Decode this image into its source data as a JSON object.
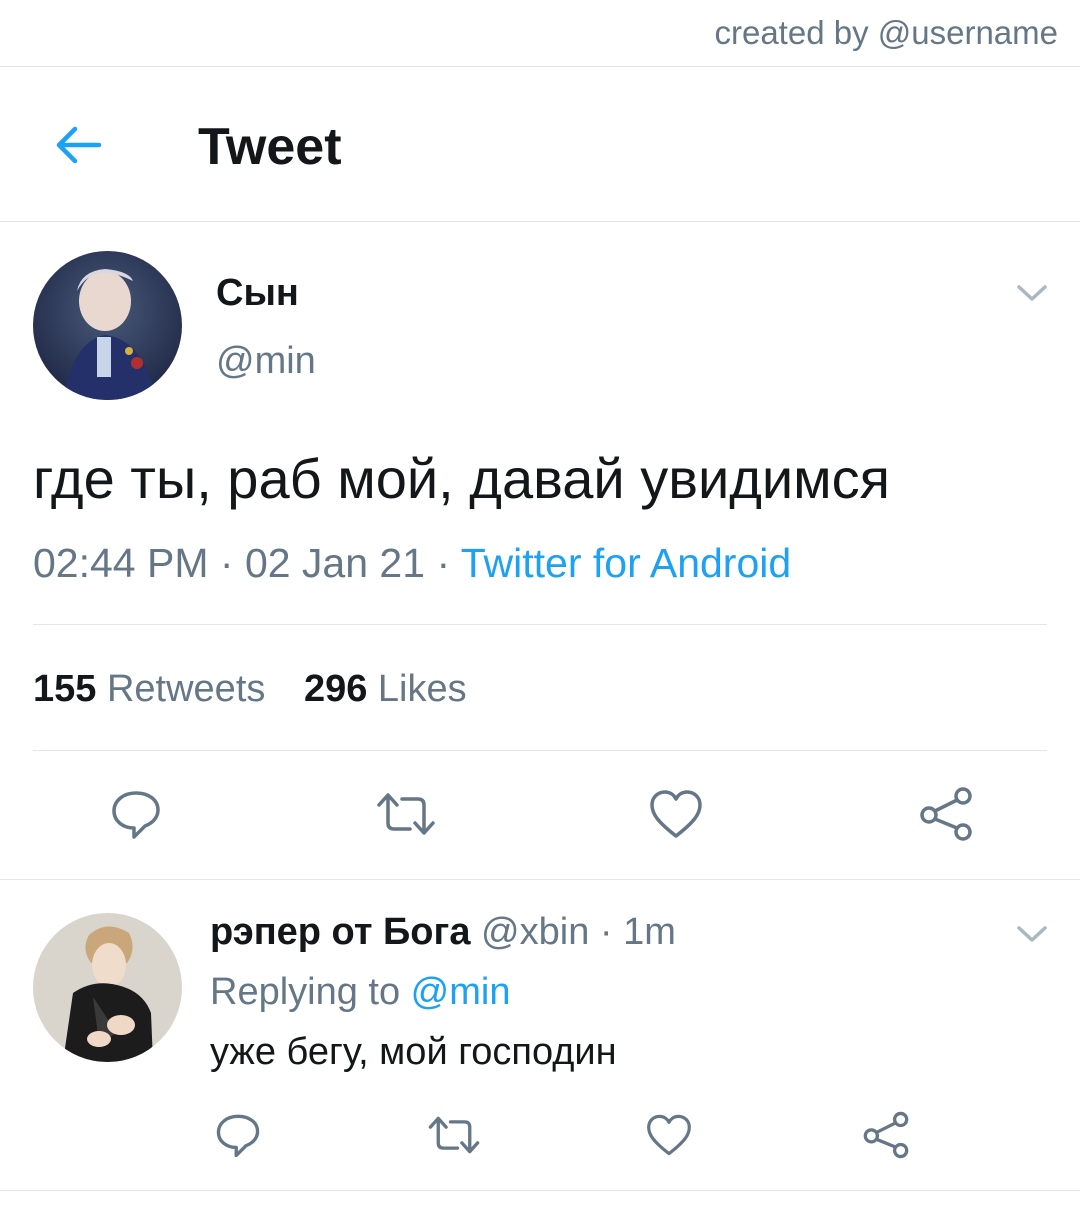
{
  "watermark": "created by @username",
  "header": {
    "title": "Tweet"
  },
  "tweet": {
    "display_name": "Сын",
    "handle": "@min",
    "text": "где ты, раб мой, давай увидимся",
    "time": "02:44 PM",
    "sep1": " · ",
    "date": "02 Jan 21",
    "sep2": " · ",
    "source": "Twitter for Android",
    "retweets_count": "155",
    "retweets_label": "Retweets",
    "likes_count": "296",
    "likes_label": "Likes"
  },
  "reply": {
    "display_name": "рэпер от Бога",
    "handle": "@xbin",
    "sep": " · ",
    "time": "1m",
    "replying_prefix": "Replying to ",
    "replying_mention": "@min",
    "text": "уже бегу, мой господин"
  },
  "colors": {
    "accent": "#1da1f2",
    "text_primary": "#14171a",
    "text_secondary": "#657786",
    "divider": "#e1e8ed"
  },
  "icons": {
    "back": "arrow-left-icon",
    "caret": "chevron-down-icon",
    "reply": "speech-bubble-icon",
    "retweet": "retweet-icon",
    "like": "heart-icon",
    "share": "share-icon"
  }
}
